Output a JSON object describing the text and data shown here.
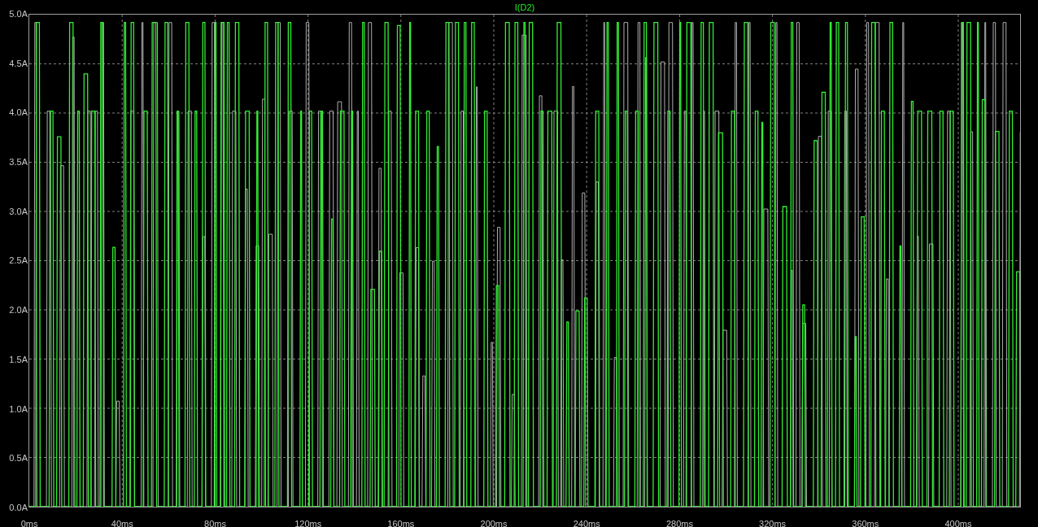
{
  "title": "I(D2)",
  "y_axis_labels": [
    "5.0A",
    "4.5A",
    "4.0A",
    "3.5A",
    "3.0A",
    "2.5A",
    "2.0A",
    "1.5A",
    "1.0A",
    "0.5A",
    "0.0A"
  ],
  "x_axis_labels": [
    "0ms",
    "40ms",
    "80ms",
    "120ms",
    "160ms",
    "200ms",
    "240ms",
    "280ms",
    "320ms",
    "360ms",
    "400ms"
  ]
}
